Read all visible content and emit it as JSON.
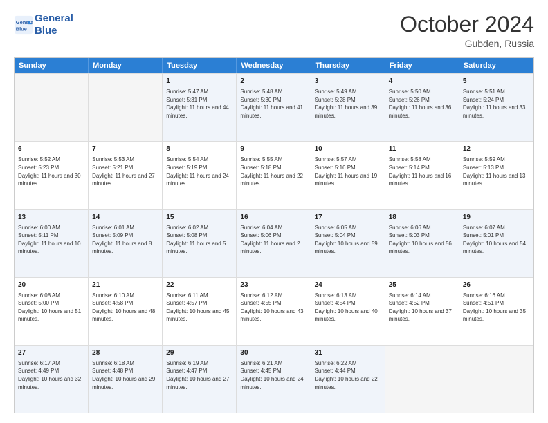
{
  "header": {
    "logo_line1": "General",
    "logo_line2": "Blue",
    "month": "October 2024",
    "location": "Gubden, Russia"
  },
  "days_of_week": [
    "Sunday",
    "Monday",
    "Tuesday",
    "Wednesday",
    "Thursday",
    "Friday",
    "Saturday"
  ],
  "rows": [
    [
      {
        "day": "",
        "sunrise": "",
        "sunset": "",
        "daylight": "",
        "empty": true
      },
      {
        "day": "",
        "sunrise": "",
        "sunset": "",
        "daylight": "",
        "empty": true
      },
      {
        "day": "1",
        "sunrise": "Sunrise: 5:47 AM",
        "sunset": "Sunset: 5:31 PM",
        "daylight": "Daylight: 11 hours and 44 minutes."
      },
      {
        "day": "2",
        "sunrise": "Sunrise: 5:48 AM",
        "sunset": "Sunset: 5:30 PM",
        "daylight": "Daylight: 11 hours and 41 minutes."
      },
      {
        "day": "3",
        "sunrise": "Sunrise: 5:49 AM",
        "sunset": "Sunset: 5:28 PM",
        "daylight": "Daylight: 11 hours and 39 minutes."
      },
      {
        "day": "4",
        "sunrise": "Sunrise: 5:50 AM",
        "sunset": "Sunset: 5:26 PM",
        "daylight": "Daylight: 11 hours and 36 minutes."
      },
      {
        "day": "5",
        "sunrise": "Sunrise: 5:51 AM",
        "sunset": "Sunset: 5:24 PM",
        "daylight": "Daylight: 11 hours and 33 minutes."
      }
    ],
    [
      {
        "day": "6",
        "sunrise": "Sunrise: 5:52 AM",
        "sunset": "Sunset: 5:23 PM",
        "daylight": "Daylight: 11 hours and 30 minutes."
      },
      {
        "day": "7",
        "sunrise": "Sunrise: 5:53 AM",
        "sunset": "Sunset: 5:21 PM",
        "daylight": "Daylight: 11 hours and 27 minutes."
      },
      {
        "day": "8",
        "sunrise": "Sunrise: 5:54 AM",
        "sunset": "Sunset: 5:19 PM",
        "daylight": "Daylight: 11 hours and 24 minutes."
      },
      {
        "day": "9",
        "sunrise": "Sunrise: 5:55 AM",
        "sunset": "Sunset: 5:18 PM",
        "daylight": "Daylight: 11 hours and 22 minutes."
      },
      {
        "day": "10",
        "sunrise": "Sunrise: 5:57 AM",
        "sunset": "Sunset: 5:16 PM",
        "daylight": "Daylight: 11 hours and 19 minutes."
      },
      {
        "day": "11",
        "sunrise": "Sunrise: 5:58 AM",
        "sunset": "Sunset: 5:14 PM",
        "daylight": "Daylight: 11 hours and 16 minutes."
      },
      {
        "day": "12",
        "sunrise": "Sunrise: 5:59 AM",
        "sunset": "Sunset: 5:13 PM",
        "daylight": "Daylight: 11 hours and 13 minutes."
      }
    ],
    [
      {
        "day": "13",
        "sunrise": "Sunrise: 6:00 AM",
        "sunset": "Sunset: 5:11 PM",
        "daylight": "Daylight: 11 hours and 10 minutes."
      },
      {
        "day": "14",
        "sunrise": "Sunrise: 6:01 AM",
        "sunset": "Sunset: 5:09 PM",
        "daylight": "Daylight: 11 hours and 8 minutes."
      },
      {
        "day": "15",
        "sunrise": "Sunrise: 6:02 AM",
        "sunset": "Sunset: 5:08 PM",
        "daylight": "Daylight: 11 hours and 5 minutes."
      },
      {
        "day": "16",
        "sunrise": "Sunrise: 6:04 AM",
        "sunset": "Sunset: 5:06 PM",
        "daylight": "Daylight: 11 hours and 2 minutes."
      },
      {
        "day": "17",
        "sunrise": "Sunrise: 6:05 AM",
        "sunset": "Sunset: 5:04 PM",
        "daylight": "Daylight: 10 hours and 59 minutes."
      },
      {
        "day": "18",
        "sunrise": "Sunrise: 6:06 AM",
        "sunset": "Sunset: 5:03 PM",
        "daylight": "Daylight: 10 hours and 56 minutes."
      },
      {
        "day": "19",
        "sunrise": "Sunrise: 6:07 AM",
        "sunset": "Sunset: 5:01 PM",
        "daylight": "Daylight: 10 hours and 54 minutes."
      }
    ],
    [
      {
        "day": "20",
        "sunrise": "Sunrise: 6:08 AM",
        "sunset": "Sunset: 5:00 PM",
        "daylight": "Daylight: 10 hours and 51 minutes."
      },
      {
        "day": "21",
        "sunrise": "Sunrise: 6:10 AM",
        "sunset": "Sunset: 4:58 PM",
        "daylight": "Daylight: 10 hours and 48 minutes."
      },
      {
        "day": "22",
        "sunrise": "Sunrise: 6:11 AM",
        "sunset": "Sunset: 4:57 PM",
        "daylight": "Daylight: 10 hours and 45 minutes."
      },
      {
        "day": "23",
        "sunrise": "Sunrise: 6:12 AM",
        "sunset": "Sunset: 4:55 PM",
        "daylight": "Daylight: 10 hours and 43 minutes."
      },
      {
        "day": "24",
        "sunrise": "Sunrise: 6:13 AM",
        "sunset": "Sunset: 4:54 PM",
        "daylight": "Daylight: 10 hours and 40 minutes."
      },
      {
        "day": "25",
        "sunrise": "Sunrise: 6:14 AM",
        "sunset": "Sunset: 4:52 PM",
        "daylight": "Daylight: 10 hours and 37 minutes."
      },
      {
        "day": "26",
        "sunrise": "Sunrise: 6:16 AM",
        "sunset": "Sunset: 4:51 PM",
        "daylight": "Daylight: 10 hours and 35 minutes."
      }
    ],
    [
      {
        "day": "27",
        "sunrise": "Sunrise: 6:17 AM",
        "sunset": "Sunset: 4:49 PM",
        "daylight": "Daylight: 10 hours and 32 minutes."
      },
      {
        "day": "28",
        "sunrise": "Sunrise: 6:18 AM",
        "sunset": "Sunset: 4:48 PM",
        "daylight": "Daylight: 10 hours and 29 minutes."
      },
      {
        "day": "29",
        "sunrise": "Sunrise: 6:19 AM",
        "sunset": "Sunset: 4:47 PM",
        "daylight": "Daylight: 10 hours and 27 minutes."
      },
      {
        "day": "30",
        "sunrise": "Sunrise: 6:21 AM",
        "sunset": "Sunset: 4:45 PM",
        "daylight": "Daylight: 10 hours and 24 minutes."
      },
      {
        "day": "31",
        "sunrise": "Sunrise: 6:22 AM",
        "sunset": "Sunset: 4:44 PM",
        "daylight": "Daylight: 10 hours and 22 minutes."
      },
      {
        "day": "",
        "sunrise": "",
        "sunset": "",
        "daylight": "",
        "empty": true
      },
      {
        "day": "",
        "sunrise": "",
        "sunset": "",
        "daylight": "",
        "empty": true
      }
    ]
  ],
  "alt_rows": [
    0,
    2,
    4
  ]
}
